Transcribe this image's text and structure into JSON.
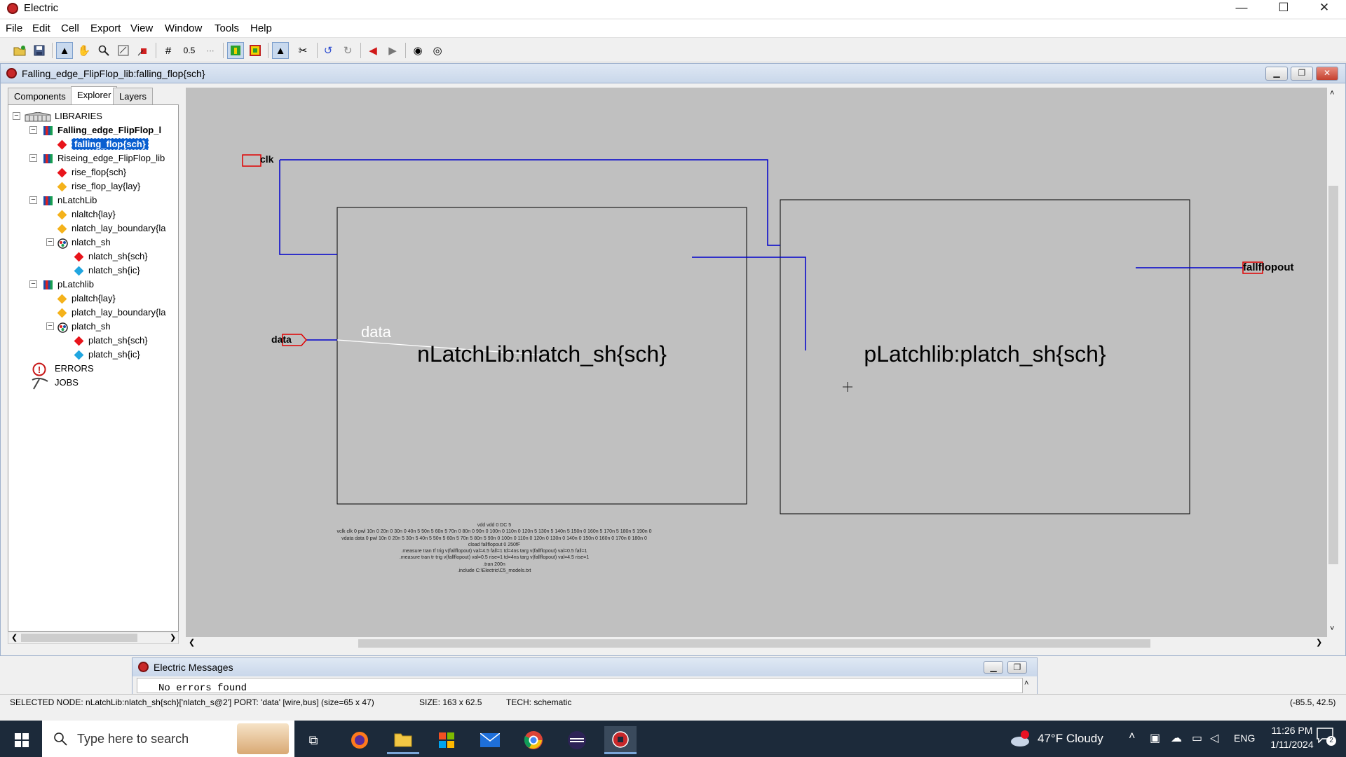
{
  "app": {
    "title": "Electric",
    "controls": {
      "minimize": "—",
      "maximize": "☐",
      "close": "✕"
    }
  },
  "menu": [
    "File",
    "Edit",
    "Cell",
    "Export",
    "View",
    "Window",
    "Tools",
    "Help"
  ],
  "toolbar": {
    "grid_value": "0.5"
  },
  "window": {
    "title": "Falling_edge_FlipFlop_lib:falling_flop{sch}"
  },
  "panel": {
    "tabs": [
      "Components",
      "Explorer",
      "Layers"
    ],
    "tree": {
      "root": "LIBRARIES",
      "lib1": "Falling_edge_FlipFlop_l",
      "lib1_cell": "falling_flop{sch}",
      "lib2": "Riseing_edge_FlipFlop_lib",
      "lib2_cell1": "rise_flop{sch}",
      "lib2_cell2": "rise_flop_lay{lay}",
      "lib3": "nLatchLib",
      "lib3_cell1": "nlaltch{lay}",
      "lib3_cell2": "nlatch_lay_boundary{la",
      "lib3_group": "nlatch_sh",
      "lib3_group_c1": "nlatch_sh{sch}",
      "lib3_group_c2": "nlatch_sh{ic}",
      "lib4": "pLatchlib",
      "lib4_cell1": "plaltch{lay}",
      "lib4_cell2": "platch_lay_boundary{la",
      "lib4_group": "platch_sh",
      "lib4_group_c1": "platch_sh{sch}",
      "lib4_group_c2": "platch_sh{ic}",
      "errors": "ERRORS",
      "jobs": "JOBS"
    }
  },
  "schematic": {
    "port_clk": "clk",
    "port_data": "data",
    "port_out": "fallflopout",
    "wire_label_data": "data",
    "instance1": "nLatchLib:nlatch_sh{sch}",
    "instance2": "pLatchlib:platch_sh{sch}",
    "spice": [
      "vdd vdd 0 DC 5",
      "vclk clk 0 pwl 10n 0 20n 0 30n 0 40n 5 50n 5 60n 5 70n 0 80n 0 90n 0 100n 0 110n 0 120n 5 130n 5 140n 5 150n 0 160n 5 170n 5 180n 5 190n 0",
      "vdata data 0 pwl 10n 0 20n 5 30n 5 40n 5 50n 5 60n 5 70n 5 80n 5 90n 0 100n 0 110n 0 120n 0 130n 0 140n 0 150n 0 160n 0 170n 0 180n 0",
      "cload fallflopout 0 250fF",
      ".measure tran tf trig v(fallflopout) val=4.5 fall=1 td=4ns targ v(fallflopout) val=0.5 fall=1",
      ".measure tran tr trig v(fallflopout) val=0.5 rise=1 td=4ns targ v(fallflopout) val=4.5 rise=1",
      ".tran 200n",
      ".include C:\\Electric\\C5_models.txt"
    ]
  },
  "messages": {
    "title": "Electric Messages",
    "text": "No errors found"
  },
  "status": {
    "selected": "SELECTED NODE: nLatchLib:nlatch_sh{sch}['nlatch_s@2'] PORT: 'data' [wire,bus] (size=65 x 47)",
    "size": "SIZE: 163 x 62.5",
    "tech": "TECH: schematic",
    "coords": "(-85.5, 42.5)"
  },
  "taskbar": {
    "search_placeholder": "Type here to search",
    "weather": "47°F  Cloudy",
    "lang": "ENG",
    "time": "11:26 PM",
    "date": "1/11/2024",
    "notif_count": "2"
  }
}
